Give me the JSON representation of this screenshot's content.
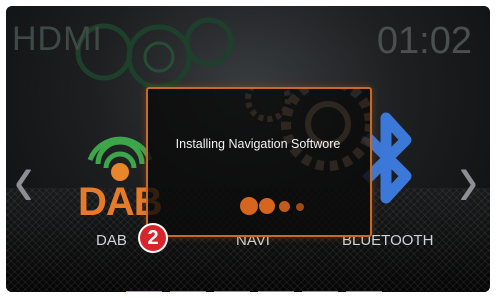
{
  "status": {
    "source_label": "HDMI",
    "clock": "01:02"
  },
  "icons": {
    "prev": "chevron-left-icon",
    "next": "chevron-right-icon",
    "dab": "dab-radio-icon",
    "bluetooth": "bluetooth-icon"
  },
  "apps": [
    {
      "label": "DAB",
      "logo_text": "DAB"
    },
    {
      "label": "NAVI"
    },
    {
      "label": "BLUETOOTH"
    }
  ],
  "dialog": {
    "message": "Installing Navigation Softwore"
  },
  "callout": {
    "number": "2"
  },
  "pager": {
    "pages": 6,
    "active_index": 0
  },
  "colors": {
    "accent": "#e8862c",
    "badge": "#d8242b",
    "bluetooth": "#3b78d8"
  }
}
